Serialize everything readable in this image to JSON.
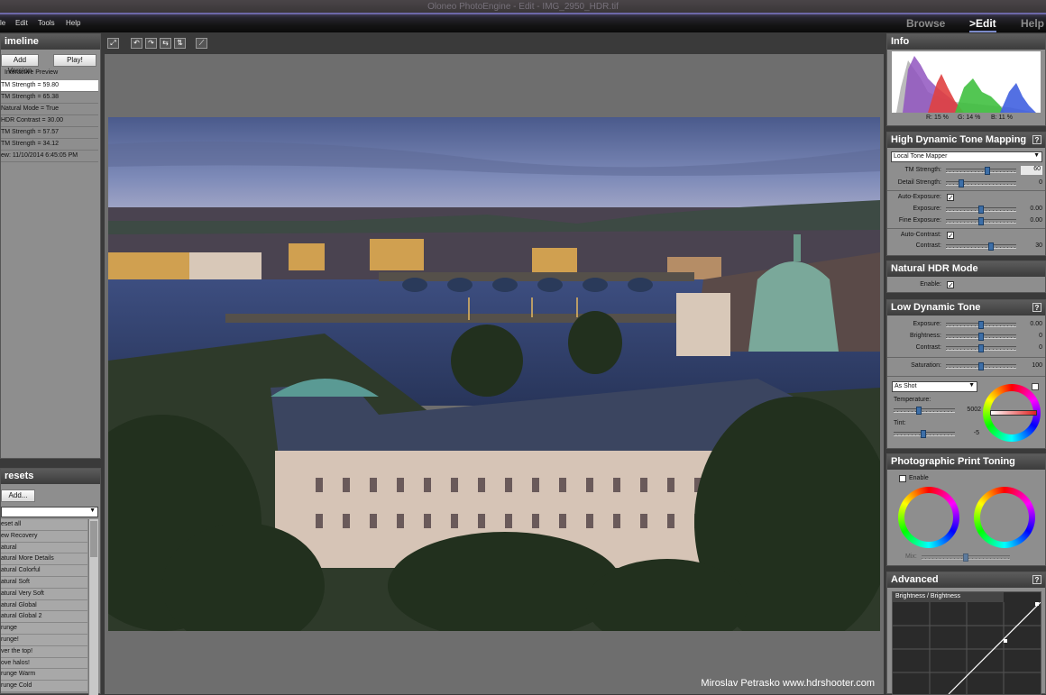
{
  "window": {
    "title": "Oloneo PhotoEngine - Edit - IMG_2950_HDR.tif"
  },
  "menu": {
    "items": [
      "le",
      "Edit",
      "Tools",
      "Help"
    ]
  },
  "modes": {
    "browse": "Browse",
    "edit": ">Edit",
    "help": "Help"
  },
  "timeline": {
    "title": "imeline",
    "add_version": "Add Version",
    "play": "Play!",
    "interactive_preview": "Interactive Preview",
    "entries": [
      "TM Strength = 59.80",
      "TM Strength = 65.38",
      "Natural Mode = True",
      "HDR Contrast = 30.00",
      "TM Strength = 57.57",
      "TM Strength = 34.12",
      "ew: 11/10/2014 6:45:05 PM"
    ]
  },
  "presets": {
    "title": "resets",
    "add": "Add...",
    "items": [
      "eset all",
      "ew Recovery",
      "atural",
      "atural More Details",
      "atural Colorful",
      "atural Soft",
      "atural Very Soft",
      "atural Global",
      "atural Global 2",
      "runge",
      "runge!",
      "ver the top!",
      "ove halos!",
      "runge Warm",
      "runge Cold"
    ]
  },
  "photo": {
    "credit": "Miroslav  Petrasko  www.hdrshooter.com"
  },
  "info": {
    "title": "Info",
    "r": "R: 15 %",
    "g": "G: 14 %",
    "b": "B: 11 %"
  },
  "hdtm": {
    "title": "High Dynamic Tone Mapping",
    "mapper": "Local Tone Mapper",
    "tm_strength_label": "TM Strength:",
    "tm_strength_value": "60",
    "tm_strength": 0.6,
    "detail_label": "Detail Strength:",
    "detail_value": "0",
    "detail": 0.2,
    "auto_exposure_label": "Auto-Exposure:",
    "exposure_label": "Exposure:",
    "exposure_value": "0.00",
    "exposure": 0.5,
    "fine_exposure_label": "Fine Exposure:",
    "fine_exposure_value": "0.00",
    "fine_exposure": 0.5,
    "auto_contrast_label": "Auto-Contrast:",
    "contrast_label": "Contrast:",
    "contrast_value": "30",
    "contrast": 0.65
  },
  "natural": {
    "title": "Natural HDR Mode",
    "enable_label": "Enable:"
  },
  "ldt": {
    "title": "Low Dynamic Tone",
    "exposure_label": "Exposure:",
    "exposure_value": "0.00",
    "exposure": 0.5,
    "brightness_label": "Brightness:",
    "brightness_value": "0",
    "brightness": 0.5,
    "contrast_label": "Contrast:",
    "contrast_value": "0",
    "contrast": 0.5,
    "saturation_label": "Saturation:",
    "saturation_value": "100",
    "saturation": 0.5,
    "wb": "As Shot",
    "temperature_label": "Temperature:",
    "temperature_value": "5002",
    "temperature": 0.4,
    "tint_label": "Tint:",
    "tint_value": "-5",
    "tint": 0.48
  },
  "toning": {
    "title": "Photographic Print Toning",
    "enable_label": "Enable",
    "mix_label": "Mix:"
  },
  "advanced": {
    "title": "Advanced",
    "curve_label": "Brightness / Brightness"
  },
  "colors": {
    "accent": "#7b8ac8",
    "knob": "#3d6fa8",
    "panel": "#8e8e8e"
  }
}
